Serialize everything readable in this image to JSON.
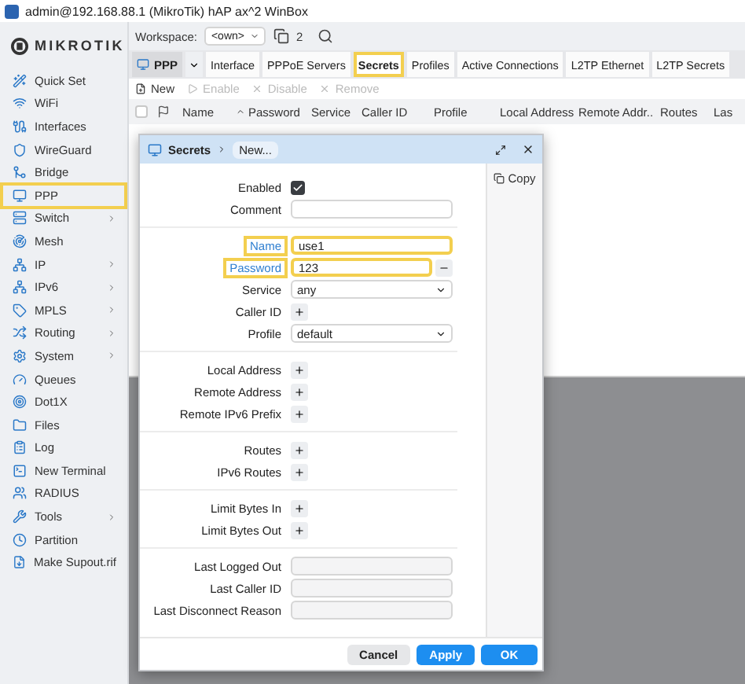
{
  "window": {
    "title": "admin@192.168.88.1 (MikroTik) hAP ax^2 WinBox"
  },
  "logo": {
    "text": "MIKROTIK"
  },
  "sidebar": {
    "items": [
      {
        "label": "Quick Set",
        "submenu": false,
        "highlighted": false
      },
      {
        "label": "WiFi",
        "submenu": false,
        "highlighted": false
      },
      {
        "label": "Interfaces",
        "submenu": false,
        "highlighted": false
      },
      {
        "label": "WireGuard",
        "submenu": false,
        "highlighted": false
      },
      {
        "label": "Bridge",
        "submenu": false,
        "highlighted": false
      },
      {
        "label": "PPP",
        "submenu": false,
        "highlighted": true
      },
      {
        "label": "Switch",
        "submenu": true,
        "highlighted": false
      },
      {
        "label": "Mesh",
        "submenu": false,
        "highlighted": false
      },
      {
        "label": "IP",
        "submenu": true,
        "highlighted": false
      },
      {
        "label": "IPv6",
        "submenu": true,
        "highlighted": false
      },
      {
        "label": "MPLS",
        "submenu": true,
        "highlighted": false
      },
      {
        "label": "Routing",
        "submenu": true,
        "highlighted": false
      },
      {
        "label": "System",
        "submenu": true,
        "highlighted": false
      },
      {
        "label": "Queues",
        "submenu": false,
        "highlighted": false
      },
      {
        "label": "Dot1X",
        "submenu": false,
        "highlighted": false
      },
      {
        "label": "Files",
        "submenu": false,
        "highlighted": false
      },
      {
        "label": "Log",
        "submenu": false,
        "highlighted": false
      },
      {
        "label": "New Terminal",
        "submenu": false,
        "highlighted": false
      },
      {
        "label": "RADIUS",
        "submenu": false,
        "highlighted": false
      },
      {
        "label": "Tools",
        "submenu": true,
        "highlighted": false
      },
      {
        "label": "Partition",
        "submenu": false,
        "highlighted": false
      },
      {
        "label": "Make Supout.rif",
        "submenu": false,
        "highlighted": false
      }
    ]
  },
  "topbar": {
    "workspace_label": "Workspace:",
    "workspace_value": "<own>",
    "window_count": "2"
  },
  "ppp": {
    "title": "PPP",
    "select_all_checked": false,
    "tabs": [
      {
        "label": "Interface",
        "selected": false,
        "highlighted": false
      },
      {
        "label": "PPPoE Servers",
        "selected": false,
        "highlighted": false
      },
      {
        "label": "Secrets",
        "selected": true,
        "highlighted": true
      },
      {
        "label": "Profiles",
        "selected": false,
        "highlighted": false
      },
      {
        "label": "Active Connections",
        "selected": false,
        "highlighted": false
      },
      {
        "label": "L2TP Ethernet",
        "selected": false,
        "highlighted": false
      },
      {
        "label": "L2TP Secrets",
        "selected": false,
        "highlighted": false
      }
    ],
    "toolbar": [
      {
        "label": "New",
        "disabled": false
      },
      {
        "label": "Enable",
        "disabled": true
      },
      {
        "label": "Disable",
        "disabled": true
      },
      {
        "label": "Remove",
        "disabled": true
      }
    ],
    "columns": [
      {
        "label": "Name",
        "sorted": false
      },
      {
        "label": "Password",
        "sorted": true
      },
      {
        "label": "Service",
        "sorted": false
      },
      {
        "label": "Caller ID",
        "sorted": false
      },
      {
        "label": "Profile",
        "sorted": false
      },
      {
        "label": "Local Address",
        "sorted": false
      },
      {
        "label": "Remote Addr..",
        "sorted": false
      },
      {
        "label": "Routes",
        "sorted": false
      },
      {
        "label": "Las",
        "sorted": false
      }
    ]
  },
  "dialog": {
    "breadcrumb": "Secrets",
    "title": "New...",
    "copy": "Copy",
    "groups": [
      [
        {
          "kind": "checkbox",
          "label": "Enabled",
          "checked": true,
          "highlighted": false
        },
        {
          "kind": "text",
          "label": "Comment",
          "highlighted": false
        }
      ],
      [
        {
          "kind": "text",
          "label": "Name",
          "value": "use1",
          "highlighted": true
        },
        {
          "kind": "password",
          "label": "Password",
          "value": "123",
          "highlighted": true
        },
        {
          "kind": "select",
          "label": "Service",
          "value": "any",
          "highlighted": false
        },
        {
          "kind": "plus",
          "label": "Caller ID",
          "highlighted": false
        },
        {
          "kind": "select",
          "label": "Profile",
          "value": "default",
          "highlighted": false
        }
      ],
      [
        {
          "kind": "plus",
          "label": "Local Address",
          "highlighted": false
        },
        {
          "kind": "plus",
          "label": "Remote Address",
          "highlighted": false
        },
        {
          "kind": "plus",
          "label": "Remote IPv6 Prefix",
          "highlighted": false
        }
      ],
      [
        {
          "kind": "plus",
          "label": "Routes",
          "highlighted": false
        },
        {
          "kind": "plus",
          "label": "IPv6 Routes",
          "highlighted": false
        }
      ],
      [
        {
          "kind": "plus",
          "label": "Limit Bytes In",
          "highlighted": false
        },
        {
          "kind": "plus",
          "label": "Limit Bytes Out",
          "highlighted": false
        }
      ],
      [
        {
          "kind": "readonly",
          "label": "Last Logged Out",
          "highlighted": false
        },
        {
          "kind": "readonly",
          "label": "Last Caller ID",
          "highlighted": false
        },
        {
          "kind": "readonly",
          "label": "Last Disconnect Reason",
          "highlighted": false
        }
      ]
    ],
    "buttons": [
      {
        "label": "Cancel",
        "kind": "secondary"
      },
      {
        "label": "Apply",
        "kind": "primary"
      },
      {
        "label": "OK",
        "kind": "primary"
      }
    ]
  }
}
